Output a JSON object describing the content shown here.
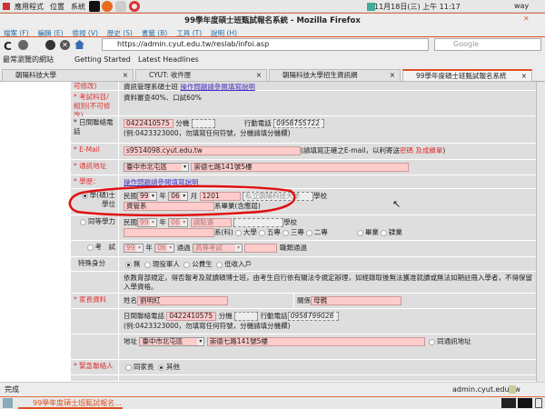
{
  "panel": {
    "menus": [
      "應用程式",
      "位置",
      "系統"
    ],
    "clock": "11月18日(三) 上午 11:17",
    "user": "way"
  },
  "window": {
    "title": "99學年度碩士班甄試報名系統 - Mozilla Firefox"
  },
  "menubar": [
    "檔案 (F)",
    "編輯 (E)",
    "檢視 (V)",
    "歷史 (S)",
    "書籤 (B)",
    "工具 (T)",
    "說明 (H)"
  ],
  "nav": {
    "url": "https://admin.cyut.edu.tw/reslab/infoi.asp",
    "search_placeholder": "Google"
  },
  "bookmarks": [
    "最常瀏覽的網站",
    "Getting Started",
    "Latest Headlines"
  ],
  "tabs": [
    "朝陽科技大學",
    "CYUT: 收件匣",
    "朝陽科技大學招生資訊網",
    "99學年度碩士班甄試報名系統"
  ],
  "form": {
    "row0": {
      "label": "可修改)",
      "value": "資訊管理系碩士班",
      "link": "操作問題請參閱填寫說明"
    },
    "subject": {
      "label": "* 考試科目/組別(不可修改)",
      "value": "資料審查40%、口試60%"
    },
    "phone": {
      "label": "* 日間聯絡電話",
      "value": "0422410575",
      "ext_label": "分機",
      "mobile_label": "行動電話",
      "mobile": "0958755722",
      "hint": "(例:0423323000，勿填寫任何符號，分機請填分機欄)"
    },
    "email": {
      "label": "* E-Mail",
      "value": "s9514098.cyut.edu.tw",
      "note": "(請填寫正確之E-mail，以利寄送",
      "note_red": "密碼 及成績單",
      "note_end": ")"
    },
    "address": {
      "label": "* 通訊地址",
      "district": "臺中市北屯區",
      "street": "崇德七路141號5樓"
    },
    "edu": {
      "label": "* 學歷：",
      "link": "操作問題請參閱填寫說明"
    },
    "bachelor": {
      "label": "學(碩)士學位",
      "roc": "民國",
      "year": "99",
      "year_label": "年",
      "month": "06",
      "month_label": "月",
      "code": "1201",
      "school": "私立朝陽科技大學",
      "school_label": "學校",
      "dept": "資管系",
      "dept_label": "系畢業(含應屆)"
    },
    "equiv": {
      "label": "同等學力",
      "roc": "民國",
      "year": "99",
      "year_label": "年",
      "month": "06",
      "select": "請點選",
      "school_label": "學校",
      "dept_label": "系(科)",
      "options": [
        "大學",
        "五專",
        "三專",
        "二專"
      ],
      "status": [
        "畢業",
        "肄業"
      ]
    },
    "exam": {
      "label": "考　試",
      "year": "99",
      "year_label": "年",
      "month": "06",
      "pass_label": "通過",
      "exam_select": "高等考試",
      "suffix": "職類通過"
    },
    "special": {
      "label": "特殊身分",
      "options": [
        "無",
        "現役軍人",
        "公費生",
        "低收入戶"
      ]
    },
    "notice": "依教育部規定，得否報考及就讀碩博士班，由考生自行依有關法令規定辦理，如經錄取後無法獲准就讀或無法如期註冊入學者，不得保留入學資格。",
    "parent": {
      "label": "* 家長資料",
      "name_label": "姓名",
      "name": "劉明紅",
      "rel_label": "關係",
      "rel": "母親",
      "phone_label": "日間聯絡電話",
      "phone": "0422410575",
      "ext_label": "分機",
      "mobile_label": "行動電話",
      "mobile": "0958799028",
      "hint": "(例:0423323000，勿填寫任何符號，分機請填分機欄)",
      "addr_label": "地址",
      "district": "臺中市北屯區",
      "street": "崇德七路141號5樓",
      "same_label": "同通訊地址"
    },
    "emergency": {
      "label": "* 緊急聯絡人",
      "options": [
        "同家長",
        "其他"
      ]
    }
  },
  "status": {
    "text": "完成",
    "host": "admin.cyut.edu.tw"
  },
  "taskbar": {
    "window": "99學年度碩士班甄試報名..."
  }
}
